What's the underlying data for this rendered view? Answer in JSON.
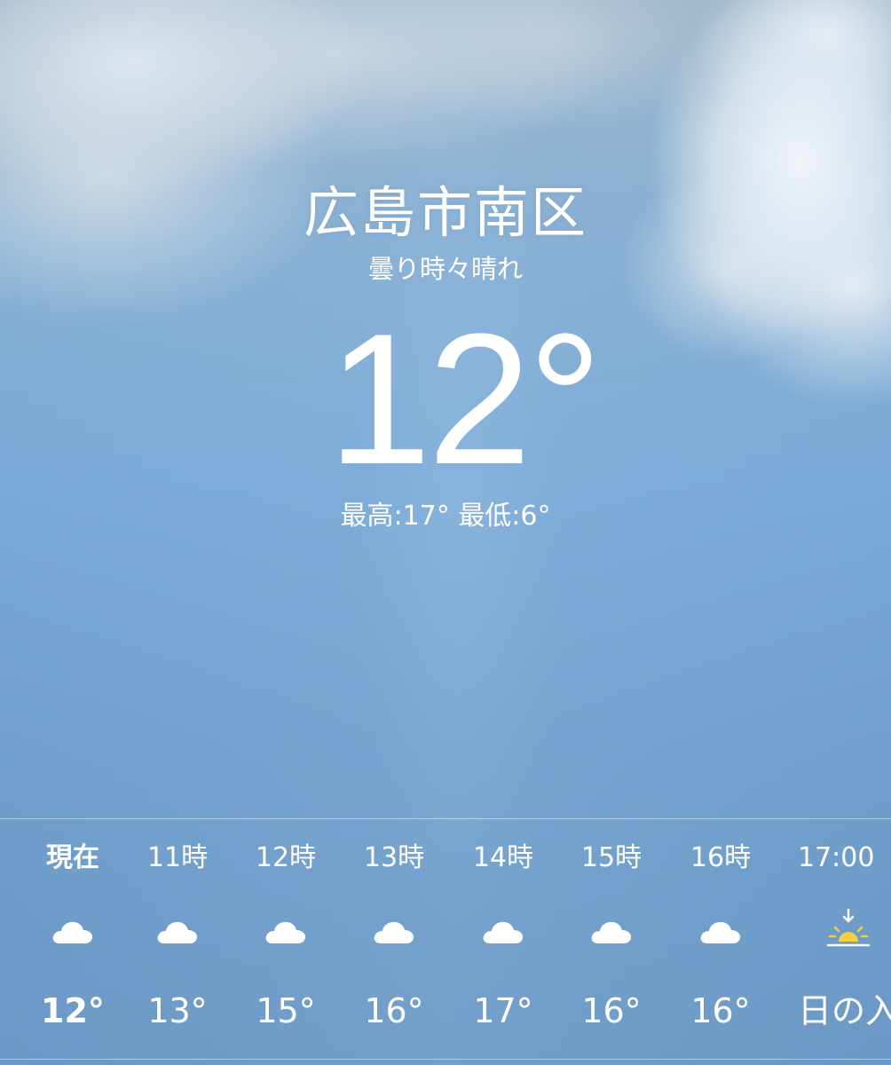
{
  "location": "広島市南区",
  "condition": "曇り時々晴れ",
  "current_temp": "12°",
  "high": "最高:17°",
  "low": "最低:6°",
  "hourly": [
    {
      "time": "現在",
      "icon": "cloud-icon",
      "temp": "12°"
    },
    {
      "time": "11時",
      "icon": "cloud-icon",
      "temp": "13°"
    },
    {
      "time": "12時",
      "icon": "cloud-icon",
      "temp": "15°"
    },
    {
      "time": "13時",
      "icon": "cloud-icon",
      "temp": "16°"
    },
    {
      "time": "14時",
      "icon": "cloud-icon",
      "temp": "17°"
    },
    {
      "time": "15時",
      "icon": "cloud-icon",
      "temp": "16°"
    },
    {
      "time": "16時",
      "icon": "cloud-icon",
      "temp": "16°"
    },
    {
      "time": "17:00",
      "icon": "sunset-icon",
      "temp": "日の入"
    }
  ],
  "colors": {
    "sky_top": "#98b2c8",
    "sky_bottom": "#6b98c4",
    "sun": "#f4d03f",
    "text": "#ffffff"
  }
}
